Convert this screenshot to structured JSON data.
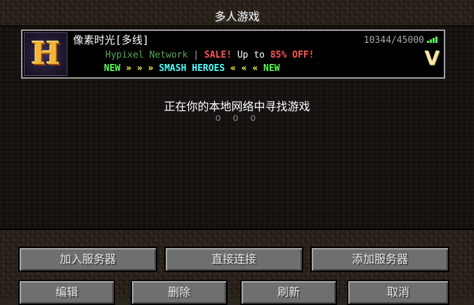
{
  "screen": {
    "title": "多人游戏"
  },
  "server": {
    "name": "像素时光[多线]",
    "players": "10344/45000",
    "motd_line1": {
      "network": "Hypixel Network",
      "sep": "|",
      "sale": "SALE!",
      "upto": "Up to",
      "percent": "85%",
      "off": "OFF!"
    },
    "motd_line2": {
      "new_left": "NEW",
      "arrows_left": "» » »",
      "event": "SMASH HEROES",
      "arrows_right": "« « «",
      "new_right": "NEW"
    },
    "icon_letter": "H",
    "badge_letter": "V",
    "signal_icon": "signal-bars-icon"
  },
  "lan": {
    "status": "正在你的本地网络中寻找游戏",
    "dots": "o o o"
  },
  "buttons": {
    "join": "加入服务器",
    "direct": "直接连接",
    "add": "添加服务器",
    "edit": "编辑",
    "delete": "删除",
    "refresh": "刷新",
    "cancel": "取消"
  }
}
